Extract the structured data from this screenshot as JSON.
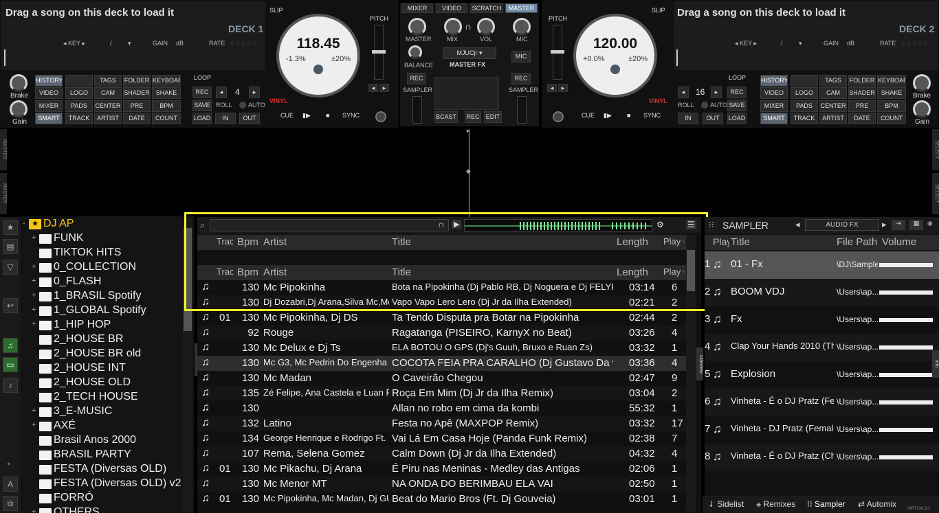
{
  "deck1": {
    "title": "Drag a song on this deck to load it",
    "name": "DECK 1",
    "key": "KEY",
    "slash": "/",
    "gain": "GAIN",
    "db": "dB",
    "rate": "RATE",
    "slip": "SLIP",
    "pitch": "PITCH",
    "bpm": "118.45",
    "pitch_left": "-1.3%",
    "pitch_right": "±20%",
    "vinyl": "VINYL",
    "cue": "CUE",
    "sync": "SYNC",
    "loop": "LOOP",
    "rec": "REC",
    "loop_val": "4",
    "save": "SAVE",
    "roll": "ROLL",
    "auto": "AUTO",
    "load": "LOAD",
    "in": "IN",
    "out": "OUT",
    "brake": "Brake",
    "gain_knob": "Gain"
  },
  "deck2": {
    "title": "Drag a song on this deck to load it",
    "name": "DECK 2",
    "key": "KEY",
    "slash": "/",
    "gain": "GAIN",
    "db": "dB",
    "rate": "RATE",
    "slip": "SLIP",
    "pitch": "PITCH",
    "bpm": "120.00",
    "pitch_left": "+0.0%",
    "pitch_right": "±20%",
    "vinyl": "VINYL",
    "cue": "CUE",
    "sync": "SYNC",
    "loop": "LOOP",
    "rec": "REC",
    "loop_val": "16",
    "save": "SAVE",
    "roll": "ROLL",
    "auto": "AUTO",
    "load": "LOAD",
    "in": "IN",
    "out": "OUT",
    "brake": "Brake",
    "gain_knob": "Gain"
  },
  "pads": {
    "history": "HISTORY",
    "tags": "TAGS",
    "folder": "FOLDER",
    "keyboard": "KEYBOARD",
    "video": "VIDEO",
    "logo": "LOGO",
    "cam": "CAM",
    "shader": "SHADER",
    "shake": "SHAKE",
    "mixer": "MIXER",
    "pads": "PADS",
    "center": "CENTER",
    "pre": "PRE",
    "bpm": "BPM",
    "smart": "SMART",
    "track": "TRACK",
    "artist": "ARTIST",
    "date": "DATE",
    "count": "COUNT"
  },
  "mixer": {
    "tabs": [
      "MIXER",
      "VIDEO",
      "SCRATCH",
      "MASTER"
    ],
    "master": "MASTER",
    "mix": "MIX",
    "vol": "VOL",
    "mic": "MIC",
    "balance": "BALANCE",
    "user": "MJUCjr",
    "master_fx": "MASTER FX",
    "rec": "REC",
    "sampler": "SAMPLER",
    "bcast": "BCAST",
    "rec2": "REC",
    "edit": "EDIT",
    "mic2": "MIC"
  },
  "side_tabs": {
    "master": "MASTER",
    "select": "SELECT",
    "folders": "folders",
    "sideview": "sideview",
    "info": "info"
  },
  "tree": {
    "root": "DJ AP",
    "items": [
      {
        "label": "FUNK",
        "plus": "+"
      },
      {
        "label": "TIKTOK HITS",
        "plus": ""
      },
      {
        "label": "0_COLLECTION",
        "plus": "+"
      },
      {
        "label": "0_FLASH",
        "plus": "+"
      },
      {
        "label": "1_BRASIL Spotify",
        "plus": "+"
      },
      {
        "label": "1_GLOBAL Spotify",
        "plus": "+"
      },
      {
        "label": "1_HIP HOP",
        "plus": "+"
      },
      {
        "label": "2_HOUSE BR",
        "plus": ""
      },
      {
        "label": "2_HOUSE BR old",
        "plus": ""
      },
      {
        "label": "2_HOUSE INT",
        "plus": ""
      },
      {
        "label": "2_HOUSE OLD",
        "plus": ""
      },
      {
        "label": "2_TECH HOUSE",
        "plus": ""
      },
      {
        "label": "3_E-MUSIC",
        "plus": "+"
      },
      {
        "label": "AXÉ",
        "plus": "+"
      },
      {
        "label": "Brasil Anos 2000",
        "plus": ""
      },
      {
        "label": "BRASIL PARTY",
        "plus": ""
      },
      {
        "label": "FESTA (Diversas OLD)",
        "plus": ""
      },
      {
        "label": "FESTA (Diversas OLD) v2",
        "plus": ""
      },
      {
        "label": "FORRÓ",
        "plus": ""
      },
      {
        "label": "OTHERS",
        "plus": "+"
      }
    ]
  },
  "list": {
    "search_value": "",
    "columns": {
      "track": "Track",
      "bpm": "Bpm",
      "artist": "Artist",
      "title": "Title",
      "length": "Length",
      "play": "Play Count"
    },
    "rows": [
      {
        "track": "",
        "bpm": "130",
        "artist": "Mc Pipokinha",
        "title": "Bota na Pipokinha (Dj Pablo RB, Dj Noguera e Dj FELYPINHO)",
        "length": "03:14",
        "play": "6"
      },
      {
        "track": "",
        "bpm": "130",
        "artist": "Dj Dozabri,Dj Arana,Silva Mc,Mc...",
        "title": "Vapo Vapo Lero Lero (Dj Jr da Ilha Extended)",
        "length": "02:21",
        "play": "2"
      },
      {
        "track": "01",
        "bpm": "130",
        "artist": "Mc Pipokinha, Dj DS",
        "title": "Ta Tendo Disputa pra Botar na Pipokinha",
        "length": "02:44",
        "play": "2"
      },
      {
        "track": "",
        "bpm": "92",
        "artist": "Rouge",
        "title": "Ragatanga (PISEIRO, KarnyX no Beat)",
        "length": "03:26",
        "play": "4"
      },
      {
        "track": "",
        "bpm": "130",
        "artist": "Mc Delux e Dj Ts",
        "title": "ELA BOTOU O GPS (Dj's Guuh, Bruxo e Ruan Zs)",
        "length": "03:32",
        "play": "1"
      },
      {
        "track": "",
        "bpm": "130",
        "artist": "Mc G3, Mc Pedrin Do Engenha",
        "title": "COCOTA FEIA PRA CARALHO (Dj Gustavo Da vs)",
        "length": "03:36",
        "play": "4"
      },
      {
        "track": "",
        "bpm": "130",
        "artist": "Mc Madan",
        "title": "O Caveirão Chegou",
        "length": "02:47",
        "play": "9"
      },
      {
        "track": "",
        "bpm": "135",
        "artist": "Zé Felipe, Ana Castela e Luan Pe...",
        "title": "Roça Em Mim (Dj Jr da Ilha Remix)",
        "length": "03:04",
        "play": "2"
      },
      {
        "track": "",
        "bpm": "130",
        "artist": "",
        "title": "Allan no robo em cima da kombi",
        "length": "55:32",
        "play": "1"
      },
      {
        "track": "",
        "bpm": "132",
        "artist": "Latino",
        "title": "Festa no Apê (MAXPOP Remix)",
        "length": "03:32",
        "play": "17"
      },
      {
        "track": "",
        "bpm": "134",
        "artist": "George Henrique e Rodrigo Ft. M...",
        "title": "Vai Lá Em Casa Hoje (Panda Funk Remix)",
        "length": "02:38",
        "play": "7"
      },
      {
        "track": "",
        "bpm": "107",
        "artist": "Rema, Selena Gomez",
        "title": "Calm Down (Dj Jr da Ilha Extended)",
        "length": "04:32",
        "play": "4"
      },
      {
        "track": "01",
        "bpm": "130",
        "artist": "Mc Pikachu, Dj Arana",
        "title": "É Piru nas Meninas - Medley das Antigas",
        "length": "02:06",
        "play": "1"
      },
      {
        "track": "",
        "bpm": "130",
        "artist": "Mc Menor MT",
        "title": "NA ONDA DO BERIMBAU ELA VAI",
        "length": "02:50",
        "play": "1"
      },
      {
        "track": "01",
        "bpm": "130",
        "artist": "Mc Pipokinha, Mc Madan, Dj GU...",
        "title": "Beat do Mario Bros (Ft. Dj Gouveia)",
        "length": "03:01",
        "play": "1"
      }
    ]
  },
  "sampler": {
    "title": "SAMPLER",
    "fx": "AUDIO FX",
    "columns": {
      "play": "Play",
      "title": "Title",
      "path": "File Path",
      "volume": "Volume"
    },
    "rows": [
      {
        "n": "1",
        "title": "01 - Fx",
        "path": "\\DJ\\Sample"
      },
      {
        "n": "2",
        "title": "BOOM VDJ",
        "path": "\\Users\\ap..."
      },
      {
        "n": "3",
        "title": "Fx",
        "path": "\\Users\\ap..."
      },
      {
        "n": "4",
        "title": "Clap Your Hands 2010 (Thi...",
        "path": "\\Users\\ap..."
      },
      {
        "n": "5",
        "title": "Explosion",
        "path": "\\Users\\ap..."
      },
      {
        "n": "6",
        "title": "Vinheta - É o DJ Pratz (Fe...",
        "path": "\\Users\\ap..."
      },
      {
        "n": "7",
        "title": "Vinheta - DJ Pratz (Female)",
        "path": "\\Users\\ap..."
      },
      {
        "n": "8",
        "title": "Vinheta - É o DJ Pratz (Child)",
        "path": "\\Users\\ap..."
      }
    ]
  },
  "bottom_tabs": {
    "sidelist": "Sidelist",
    "remixes": "Remixes",
    "sampler": "Sampler",
    "automix": "Automix",
    "virtual": "VIRTUALDJ"
  },
  "icons": {
    "note": "♫",
    "star": "★",
    "search": "⌕",
    "play": "▶",
    "gear": "⚙"
  }
}
